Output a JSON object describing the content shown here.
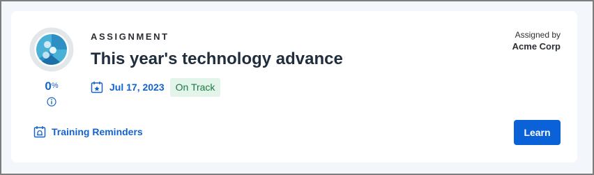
{
  "assignment": {
    "type_label": "ASSIGNMENT",
    "title": "This year's technology advance",
    "progress": {
      "value": "0",
      "unit": "%",
      "fraction": 0,
      "icon": "course-thumbnail-icon",
      "info_icon": "info-icon"
    },
    "due": {
      "icon": "calendar-star-icon",
      "date": "Jul 17, 2023"
    },
    "status": "On Track",
    "assigned_by": {
      "label": "Assigned by",
      "value": "Acme Corp"
    }
  },
  "reminders": {
    "icon": "calendar-bell-icon",
    "label": "Training Reminders"
  },
  "actions": {
    "learn_label": "Learn"
  },
  "colors": {
    "accent": "#1463cc",
    "button": "#0b61d8",
    "status_bg": "#e3f4ea",
    "status_text": "#1a7a3e",
    "ring_track": "#e4e7ea",
    "thumbnail": "#49b1d6"
  }
}
